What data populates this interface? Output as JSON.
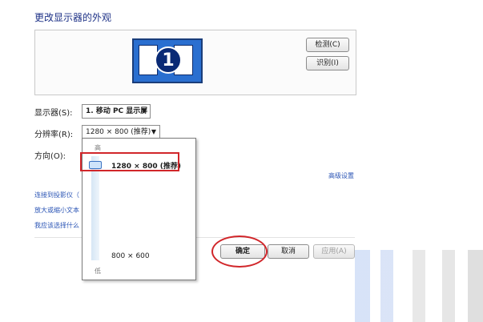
{
  "page_title": "更改显示器的外观",
  "preview": {
    "monitor_number": "1",
    "detect_button": "检测(C)",
    "identify_button": "识别(I)"
  },
  "settings": {
    "display_label": "显示器(S):",
    "display_value": "1. 移动 PC 显示屏",
    "resolution_label": "分辨率(R):",
    "resolution_value": "1280 × 800 (推荐)",
    "orientation_label": "方向(O):",
    "advanced_link": "高级设置"
  },
  "resolution_dropdown": {
    "high_label": "高",
    "low_label": "低",
    "selected_option": "1280 × 800 (推荐)",
    "min_option": "800 × 600",
    "slider_level": 1.0
  },
  "links": [
    "连接到投影仪（",
    "放大或缩小文本",
    "我应该选择什么"
  ],
  "footer": {
    "ok_button": "确定",
    "cancel_button": "取消",
    "apply_button": "应用(A)"
  },
  "colors": {
    "title": "#1e3287",
    "link": "#2b55b5",
    "highlight": "#d1262a"
  }
}
